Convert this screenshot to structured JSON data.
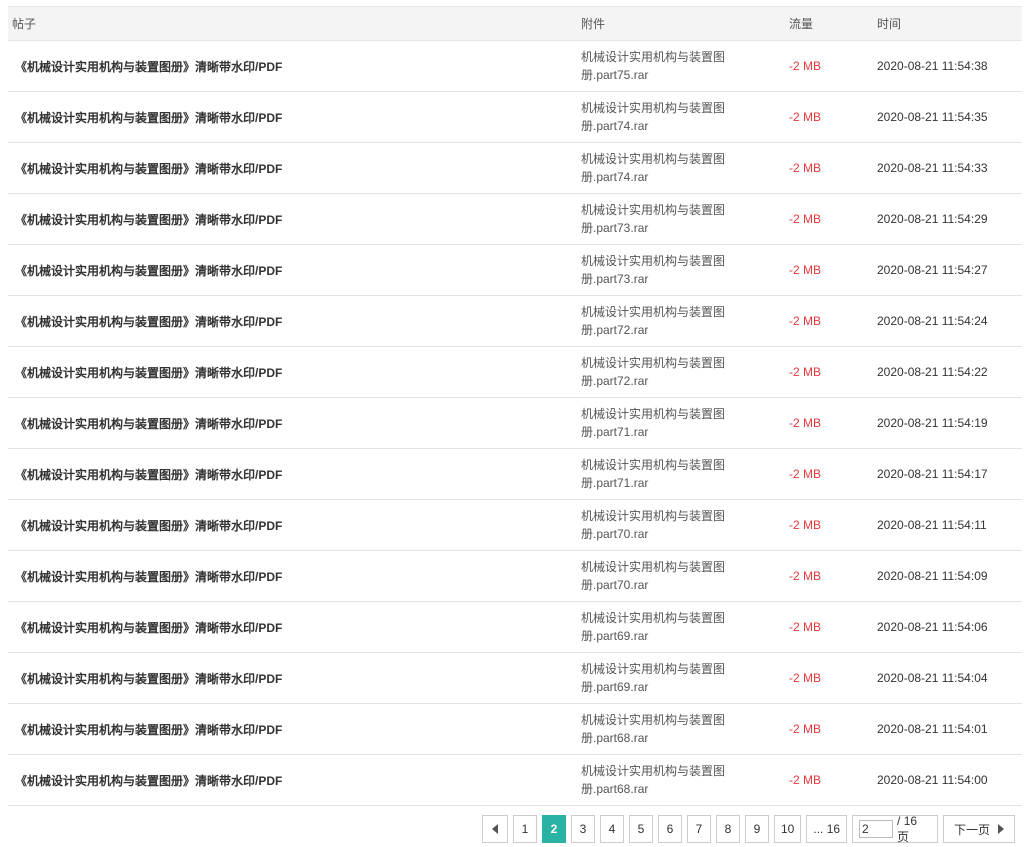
{
  "table": {
    "headers": {
      "post": "帖子",
      "attachment": "附件",
      "flow": "流量",
      "time": "时间"
    },
    "rows": [
      {
        "post": "《机械设计实用机构与装置图册》清晰带水印/PDF",
        "attachment": "机械设计实用机构与装置图册.part75.rar",
        "flow": "-2 MB",
        "time": "2020-08-21 11:54:38"
      },
      {
        "post": "《机械设计实用机构与装置图册》清晰带水印/PDF",
        "attachment": "机械设计实用机构与装置图册.part74.rar",
        "flow": "-2 MB",
        "time": "2020-08-21 11:54:35"
      },
      {
        "post": "《机械设计实用机构与装置图册》清晰带水印/PDF",
        "attachment": "机械设计实用机构与装置图册.part74.rar",
        "flow": "-2 MB",
        "time": "2020-08-21 11:54:33"
      },
      {
        "post": "《机械设计实用机构与装置图册》清晰带水印/PDF",
        "attachment": "机械设计实用机构与装置图册.part73.rar",
        "flow": "-2 MB",
        "time": "2020-08-21 11:54:29"
      },
      {
        "post": "《机械设计实用机构与装置图册》清晰带水印/PDF",
        "attachment": "机械设计实用机构与装置图册.part73.rar",
        "flow": "-2 MB",
        "time": "2020-08-21 11:54:27"
      },
      {
        "post": "《机械设计实用机构与装置图册》清晰带水印/PDF",
        "attachment": "机械设计实用机构与装置图册.part72.rar",
        "flow": "-2 MB",
        "time": "2020-08-21 11:54:24"
      },
      {
        "post": "《机械设计实用机构与装置图册》清晰带水印/PDF",
        "attachment": "机械设计实用机构与装置图册.part72.rar",
        "flow": "-2 MB",
        "time": "2020-08-21 11:54:22"
      },
      {
        "post": "《机械设计实用机构与装置图册》清晰带水印/PDF",
        "attachment": "机械设计实用机构与装置图册.part71.rar",
        "flow": "-2 MB",
        "time": "2020-08-21 11:54:19"
      },
      {
        "post": "《机械设计实用机构与装置图册》清晰带水印/PDF",
        "attachment": "机械设计实用机构与装置图册.part71.rar",
        "flow": "-2 MB",
        "time": "2020-08-21 11:54:17"
      },
      {
        "post": "《机械设计实用机构与装置图册》清晰带水印/PDF",
        "attachment": "机械设计实用机构与装置图册.part70.rar",
        "flow": "-2 MB",
        "time": "2020-08-21 11:54:11"
      },
      {
        "post": "《机械设计实用机构与装置图册》清晰带水印/PDF",
        "attachment": "机械设计实用机构与装置图册.part70.rar",
        "flow": "-2 MB",
        "time": "2020-08-21 11:54:09"
      },
      {
        "post": "《机械设计实用机构与装置图册》清晰带水印/PDF",
        "attachment": "机械设计实用机构与装置图册.part69.rar",
        "flow": "-2 MB",
        "time": "2020-08-21 11:54:06"
      },
      {
        "post": "《机械设计实用机构与装置图册》清晰带水印/PDF",
        "attachment": "机械设计实用机构与装置图册.part69.rar",
        "flow": "-2 MB",
        "time": "2020-08-21 11:54:04"
      },
      {
        "post": "《机械设计实用机构与装置图册》清晰带水印/PDF",
        "attachment": "机械设计实用机构与装置图册.part68.rar",
        "flow": "-2 MB",
        "time": "2020-08-21 11:54:01"
      },
      {
        "post": "《机械设计实用机构与装置图册》清晰带水印/PDF",
        "attachment": "机械设计实用机构与装置图册.part68.rar",
        "flow": "-2 MB",
        "time": "2020-08-21 11:54:00"
      }
    ]
  },
  "pagination": {
    "prev_icon": "triangle-left-icon",
    "pages": [
      "1",
      "2",
      "3",
      "4",
      "5",
      "6",
      "7",
      "8",
      "9",
      "10"
    ],
    "current": "2",
    "last_page_label": "... 16",
    "jump_value": "2",
    "total_label": "/ 16 页",
    "next_label": "下一页",
    "next_icon": "triangle-right-icon"
  },
  "colors": {
    "accent": "#2ab2a5",
    "flow_negative": "#e4393c",
    "header_bg": "#f4f4f4"
  }
}
